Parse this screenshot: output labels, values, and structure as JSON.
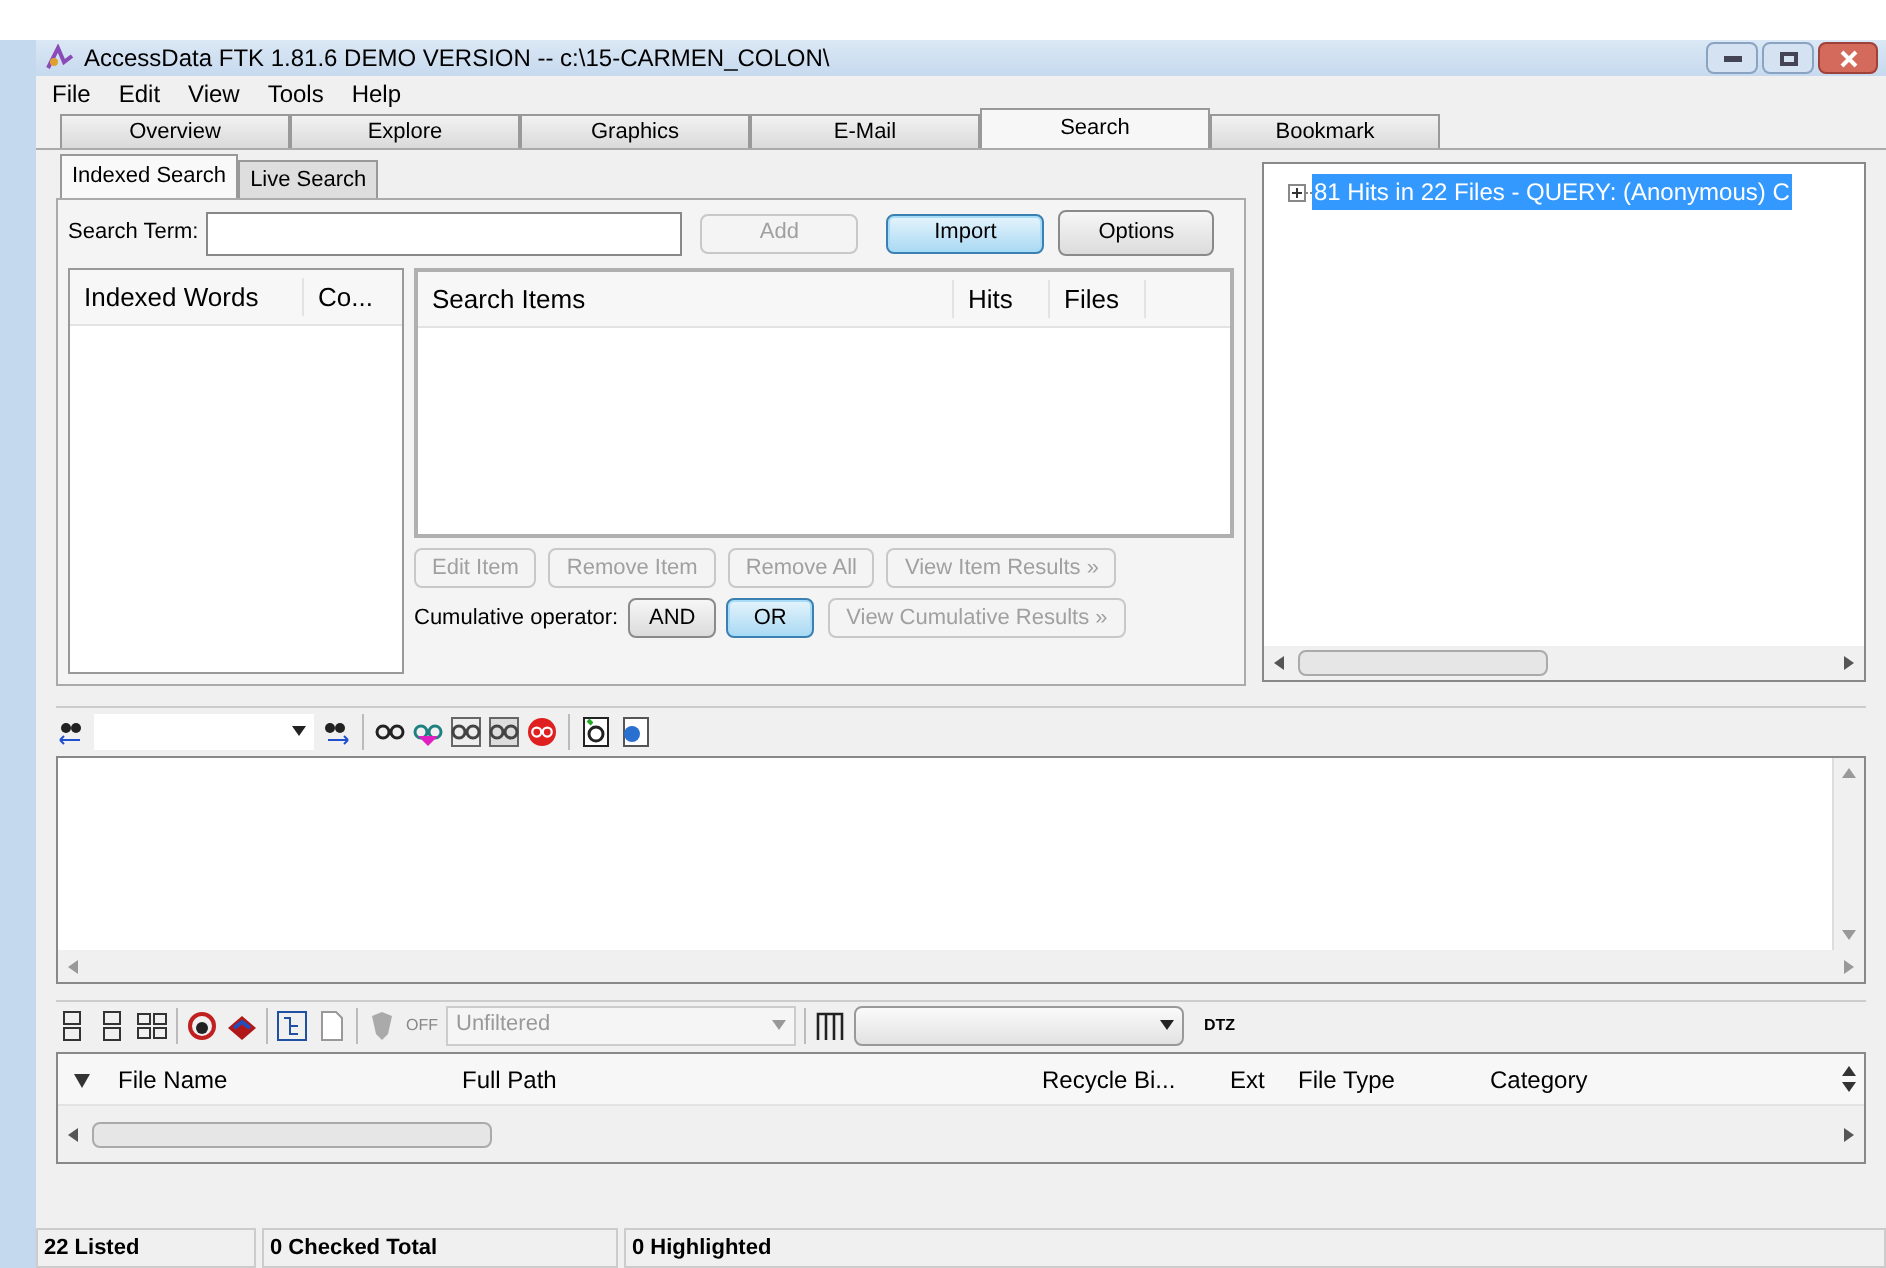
{
  "window": {
    "title": "AccessData FTK 1.81.6 DEMO VERSION -- c:\\15-CARMEN_COLON\\"
  },
  "menu": [
    "File",
    "Edit",
    "View",
    "Tools",
    "Help"
  ],
  "tabs": [
    {
      "label": "Overview",
      "selected": false
    },
    {
      "label": "Explore",
      "selected": false
    },
    {
      "label": "Graphics",
      "selected": false
    },
    {
      "label": "E-Mail",
      "selected": false
    },
    {
      "label": "Search",
      "selected": true
    },
    {
      "label": "Bookmark",
      "selected": false
    }
  ],
  "search_tabs": [
    {
      "label": "Indexed Search",
      "selected": true
    },
    {
      "label": "Live Search",
      "selected": false
    }
  ],
  "search_term": {
    "label": "Search Term:"
  },
  "term_buttons": [
    {
      "label": "Add",
      "disabled": true,
      "focused": false
    },
    {
      "label": "Import",
      "disabled": false,
      "focused": true
    },
    {
      "label": "Options",
      "disabled": false,
      "focused": false
    }
  ],
  "indexed_words": {
    "columns": [
      "Indexed Words",
      "Co..."
    ]
  },
  "search_items": {
    "columns": [
      "Search Items",
      "Hits",
      "Files"
    ]
  },
  "item_buttons": [
    {
      "label": "Edit Item",
      "disabled": true
    },
    {
      "label": "Remove Item",
      "disabled": true
    },
    {
      "label": "Remove All",
      "disabled": true
    },
    {
      "label": "View Item Results »",
      "disabled": true
    }
  ],
  "cumulative": {
    "label": "Cumulative operator:",
    "operators": [
      {
        "label": "AND",
        "selected": false
      },
      {
        "label": "OR",
        "selected": true
      }
    ],
    "results_button": {
      "label": "View Cumulative Results »",
      "disabled": true
    }
  },
  "results_tree": [
    {
      "text": "81 Hits in 22 Files - QUERY: (Anonymous) C",
      "selected": true,
      "expanded": false
    }
  ],
  "file_toolbar": {
    "filter_state": "OFF",
    "filter": "Unfiltered",
    "dtz": "DTZ"
  },
  "file_list": {
    "columns": [
      "File Name",
      "Full Path",
      "Recycle Bi...",
      "Ext",
      "File Type",
      "Category"
    ]
  },
  "status_bar": [
    "22 Listed",
    "0 Checked Total",
    "0 Highlighted"
  ]
}
